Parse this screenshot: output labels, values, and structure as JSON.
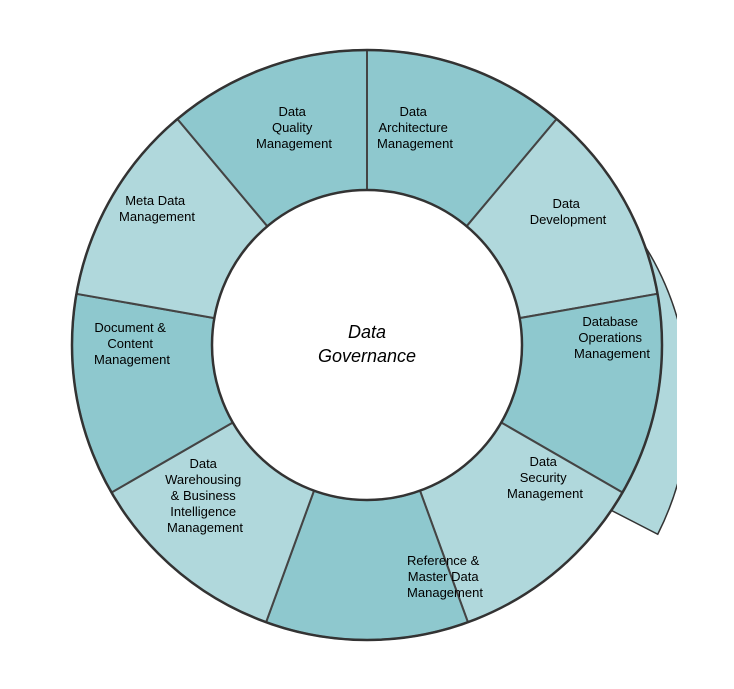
{
  "diagram": {
    "title": "Data Governance",
    "segments": [
      {
        "id": "data-architecture-management",
        "label": "Data\nArchitecture\nManagement"
      },
      {
        "id": "data-development",
        "label": "Data\nDevelopment"
      },
      {
        "id": "database-operations-management",
        "label": "Database\nOperations\nManagement"
      },
      {
        "id": "data-security-management",
        "label": "Data\nSecurity\nManagement"
      },
      {
        "id": "reference-master-data-management",
        "label": "Reference &\nMaster Data\nManagement"
      },
      {
        "id": "data-warehousing-bi-management",
        "label": "Data\nWarehousing\n& Business\nIntelligence\nManagement"
      },
      {
        "id": "document-content-management",
        "label": "Document &\nContent\nManagement"
      },
      {
        "id": "meta-data-management",
        "label": "Meta Data\nManagement"
      },
      {
        "id": "data-quality-management",
        "label": "Data\nQuality\nManagement"
      }
    ],
    "colors": {
      "outer_ring": "#b0d8dc",
      "inner_ring": "#8ec8ce",
      "center": "#ffffff",
      "stroke": "#333333",
      "text": "#000000"
    }
  }
}
